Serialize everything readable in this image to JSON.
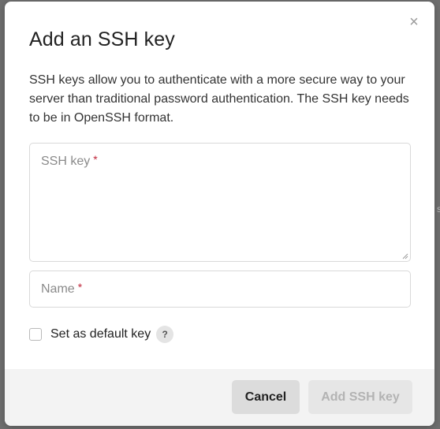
{
  "modal": {
    "title": "Add an SSH key",
    "description": "SSH keys allow you to authenticate with a more secure way to your server than traditional password authentication. The SSH key needs to be in OpenSSH format.",
    "close_glyph": "×"
  },
  "fields": {
    "ssh_key": {
      "label": "SSH key",
      "required_marker": "*",
      "value": ""
    },
    "name": {
      "label": "Name",
      "required_marker": "*",
      "value": ""
    }
  },
  "default_key": {
    "label": "Set as default key",
    "checked": false,
    "help_glyph": "?"
  },
  "footer": {
    "cancel_label": "Cancel",
    "submit_label": "Add SSH key"
  },
  "colors": {
    "required": "#c0283c",
    "overlay": "#6f6f6f",
    "footer_bg": "#f3f3f3",
    "disabled_text": "#b3b3b3"
  },
  "icons": {
    "close": "close-icon",
    "help": "question-icon",
    "resize": "resize-handle-icon"
  }
}
